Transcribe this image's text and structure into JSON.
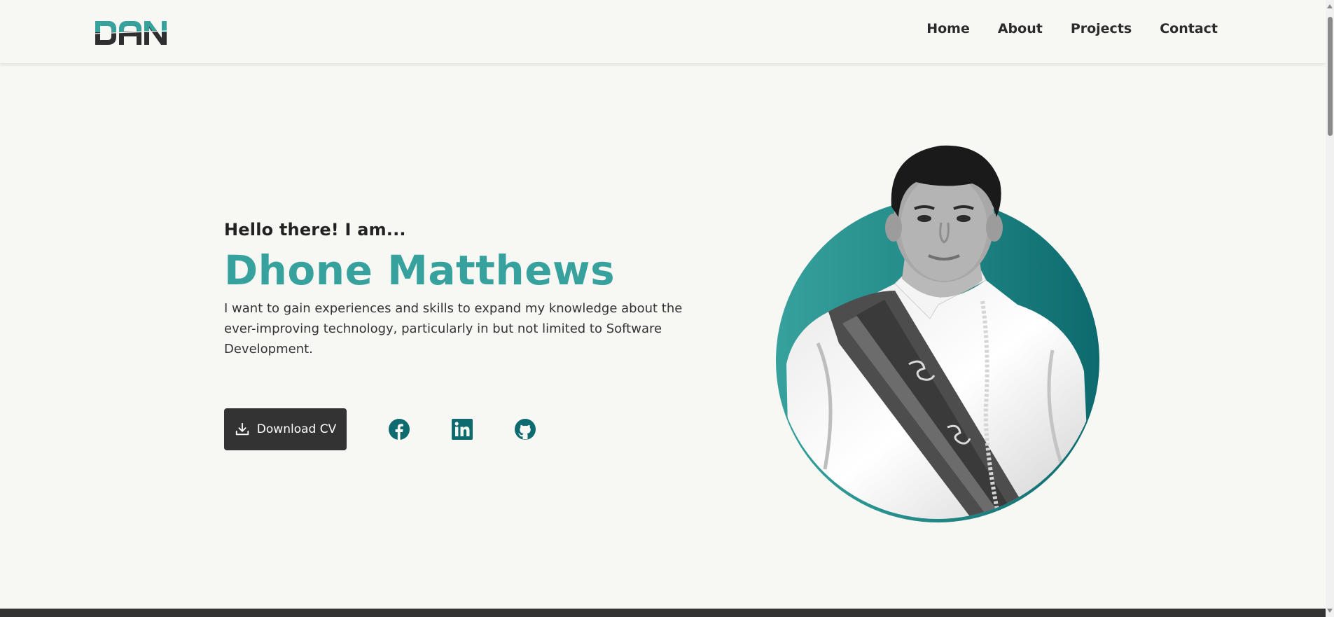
{
  "brand": {
    "logo_text": "DAN",
    "accent": "#37a19d",
    "dark_accent": "#0d6a6e"
  },
  "nav": {
    "items": [
      {
        "label": "Home"
      },
      {
        "label": "About"
      },
      {
        "label": "Projects"
      },
      {
        "label": "Contact"
      }
    ]
  },
  "hero": {
    "greeting": "Hello there! I am...",
    "name": "Dhone Matthews",
    "tagline": "I want to gain experiences and skills to expand my knowledge about the ever-improving technology, particularly in but not limited to Software Development.",
    "cv_button": {
      "label": "Download CV",
      "icon": "download-icon"
    },
    "social": [
      {
        "name": "facebook",
        "icon": "facebook-icon"
      },
      {
        "name": "linkedin",
        "icon": "linkedin-icon"
      },
      {
        "name": "github",
        "icon": "github-icon"
      }
    ]
  },
  "colors": {
    "background": "#f7f8f3",
    "text": "#2b2b2b",
    "button": "#333333",
    "icons": "#0d6a6e"
  }
}
